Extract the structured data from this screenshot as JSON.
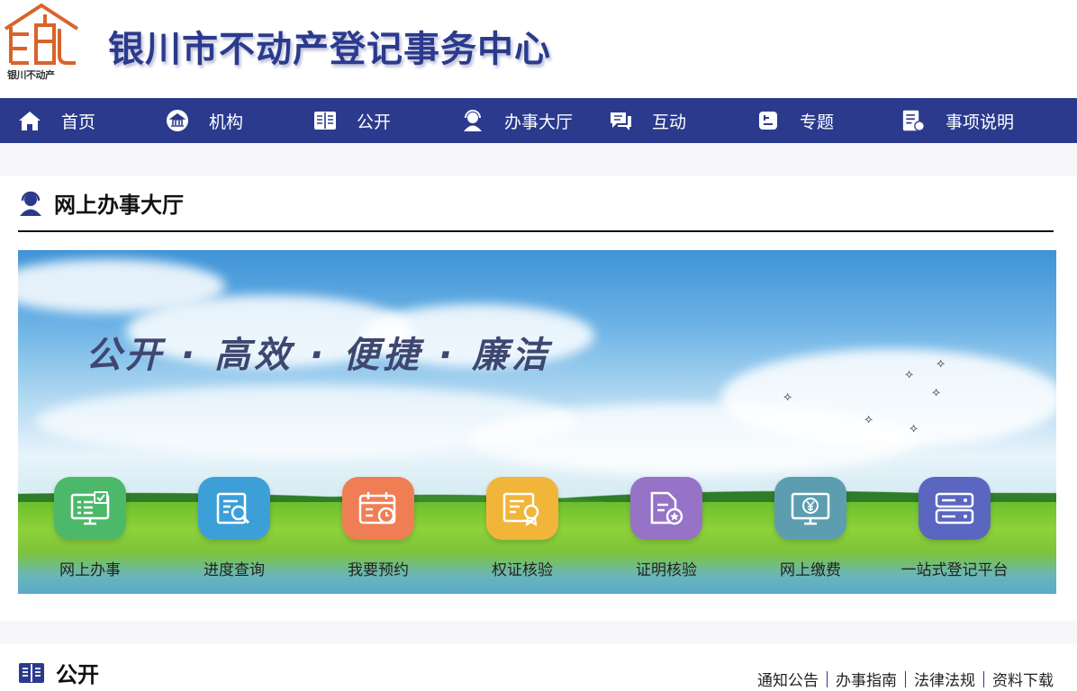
{
  "header": {
    "logo_caption": "银川不动产",
    "site_title": "银川市不动产登记事务中心"
  },
  "nav": {
    "items": [
      {
        "label": "首页",
        "icon": "home-icon"
      },
      {
        "label": "机构",
        "icon": "institution-icon"
      },
      {
        "label": "公开",
        "icon": "book-icon"
      },
      {
        "label": "办事大厅",
        "icon": "service-agent-icon"
      },
      {
        "label": "互动",
        "icon": "chat-icon"
      },
      {
        "label": "专题",
        "icon": "topic-icon"
      },
      {
        "label": "事项说明",
        "icon": "document-edit-icon"
      }
    ]
  },
  "hall": {
    "title": "网上办事大厅",
    "slogan": "公开 · 高效 · 便捷 · 廉洁",
    "services": [
      {
        "label": "网上办事",
        "icon": "monitor-check-icon",
        "color": "#4cb86a"
      },
      {
        "label": "进度查询",
        "icon": "search-document-icon",
        "color": "#3d9fd8"
      },
      {
        "label": "我要预约",
        "icon": "calendar-clock-icon",
        "color": "#ef7e55"
      },
      {
        "label": "权证核验",
        "icon": "certificate-icon",
        "color": "#f1b53a"
      },
      {
        "label": "证明核验",
        "icon": "document-star-icon",
        "color": "#9673c6"
      },
      {
        "label": "网上缴费",
        "icon": "monitor-yen-icon",
        "color": "#5c9eb0"
      },
      {
        "label": "一站式登记平台",
        "icon": "server-icon",
        "color": "#5a66c0"
      }
    ]
  },
  "public": {
    "title": "公开",
    "links": [
      "通知公告",
      "办事指南",
      "法律法规",
      "资料下载"
    ]
  },
  "colors": {
    "brand_navy": "#2b3a8c",
    "logo_orange": "#d9632a"
  }
}
